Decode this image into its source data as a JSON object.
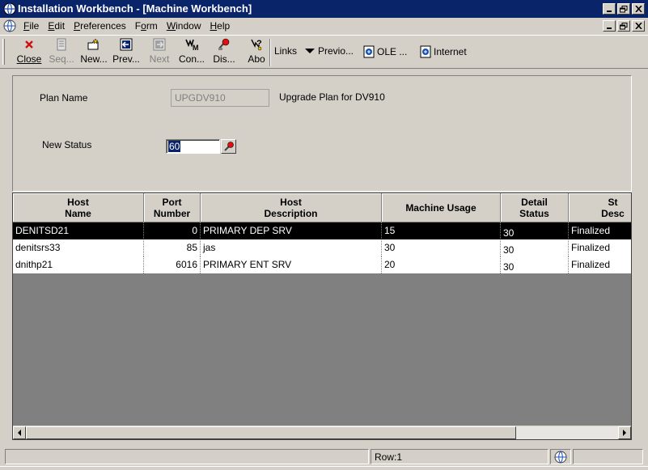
{
  "window": {
    "title": "Installation Workbench - [Machine Workbench]"
  },
  "menu": {
    "items": [
      {
        "label": "File",
        "u": "F",
        "rest": "ile"
      },
      {
        "label": "Edit",
        "u": "E",
        "rest": "dit"
      },
      {
        "label": "Preferences",
        "u": "P",
        "rest": "references"
      },
      {
        "label": "Form",
        "pre": "F",
        "u": "o",
        "rest": "rm"
      },
      {
        "label": "Window",
        "u": "W",
        "rest": "indow"
      },
      {
        "label": "Help",
        "u": "H",
        "rest": "elp"
      }
    ]
  },
  "toolbar": {
    "close": "Close",
    "seq": "Seq...",
    "new": "New...",
    "prev": "Prev...",
    "next": "Next",
    "con": "Con...",
    "dis": "Dis...",
    "abo": "Abo",
    "links": "Links",
    "previo": "Previo...",
    "ole": "OLE ...",
    "internet": "Internet"
  },
  "form": {
    "plan_name_label": "Plan Name",
    "plan_name_value": "UPGDV910",
    "plan_description": "Upgrade Plan for DV910",
    "new_status_label": "New Status",
    "new_status_value": "60"
  },
  "grid": {
    "headers": [
      {
        "line1": "Host",
        "line2": "Name"
      },
      {
        "line1": "Port",
        "line2": "Number"
      },
      {
        "line1": "Host",
        "line2": "Description"
      },
      {
        "line1": "Machine Usage",
        "line2": ""
      },
      {
        "line1": "Detail",
        "line2": "Status"
      },
      {
        "line1": "St",
        "line2": "Desc"
      }
    ],
    "rows": [
      {
        "host_name": "DENITSD21",
        "port": "0",
        "description": "PRIMARY DEP SRV",
        "usage": "15",
        "detail_status": "30",
        "status_desc": "Finalized",
        "selected": true
      },
      {
        "host_name": "denitsrs33",
        "port": "85",
        "description": "jas",
        "usage": "30",
        "detail_status": "30",
        "status_desc": "Finalized",
        "selected": false
      },
      {
        "host_name": "dnithp21",
        "port": "6016",
        "description": "PRIMARY ENT SRV",
        "usage": "20",
        "detail_status": "30",
        "status_desc": "Finalized",
        "selected": false
      }
    ]
  },
  "statusbar": {
    "row": "Row:1"
  },
  "colors": {
    "titlebar": "#0a246a",
    "selected_row": "#000000",
    "grid_background": "#808080"
  }
}
